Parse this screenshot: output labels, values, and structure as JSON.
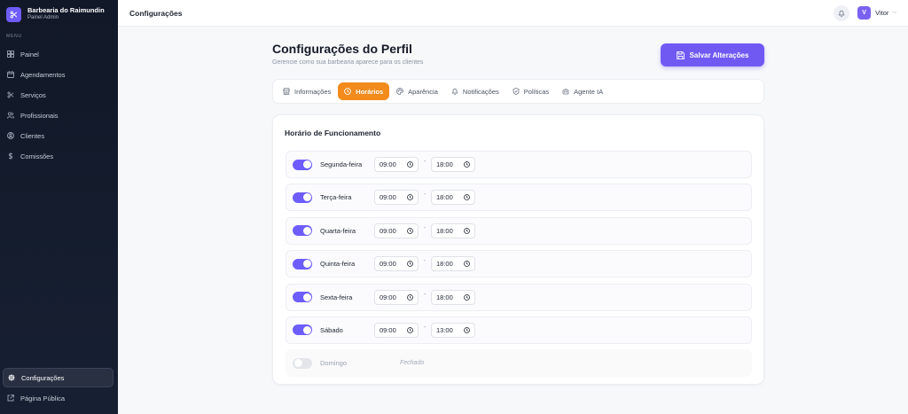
{
  "sidebar": {
    "brand_name": "Barbearia do Raimundin",
    "brand_sub": "Painel Admin",
    "menu_label": "MENU",
    "items": [
      {
        "label": "Painel",
        "icon": "grid-icon"
      },
      {
        "label": "Agendamentos",
        "icon": "calendar-icon"
      },
      {
        "label": "Serviços",
        "icon": "scissors-icon"
      },
      {
        "label": "Profissionais",
        "icon": "users-icon"
      },
      {
        "label": "Clientes",
        "icon": "user-circle-icon"
      },
      {
        "label": "Comissões",
        "icon": "dollar-icon"
      }
    ],
    "bottom": [
      {
        "label": "Configurações",
        "icon": "gear-icon"
      },
      {
        "label": "Página Pública",
        "icon": "external-link-icon"
      }
    ]
  },
  "topbar": {
    "title": "Configurações",
    "user_initial": "V",
    "user_name": "Vitor"
  },
  "page": {
    "title": "Configurações do Perfil",
    "subtitle": "Gerencie como sua barbearia aparece para os clientes",
    "save_label": "Salvar Alterações"
  },
  "tabs": [
    {
      "label": "Informações",
      "icon": "store-icon"
    },
    {
      "label": "Horários",
      "icon": "clock-icon",
      "active": true
    },
    {
      "label": "Aparência",
      "icon": "palette-icon"
    },
    {
      "label": "Notificações",
      "icon": "bell-icon"
    },
    {
      "label": "Políticas",
      "icon": "shield-icon"
    },
    {
      "label": "Agente IA",
      "icon": "robot-icon"
    }
  ],
  "hours": {
    "title": "Horário de Funcionamento",
    "separator": "-",
    "closed_label": "Fechado",
    "days": [
      {
        "name": "Segunda-feira",
        "enabled": true,
        "open": "09:00",
        "close": "18:00"
      },
      {
        "name": "Terça-feira",
        "enabled": true,
        "open": "09:00",
        "close": "18:00"
      },
      {
        "name": "Quarta-feira",
        "enabled": true,
        "open": "09:00",
        "close": "18:00"
      },
      {
        "name": "Quinta-feira",
        "enabled": true,
        "open": "09:00",
        "close": "18:00"
      },
      {
        "name": "Sexta-feira",
        "enabled": true,
        "open": "09:00",
        "close": "18:00"
      },
      {
        "name": "Sábado",
        "enabled": true,
        "open": "09:00",
        "close": "13:00"
      },
      {
        "name": "Domingo",
        "enabled": false
      }
    ]
  },
  "colors": {
    "accent": "#6d5dfc",
    "active_tab": "#f28a1c",
    "sidebar_bg": "#111827"
  }
}
